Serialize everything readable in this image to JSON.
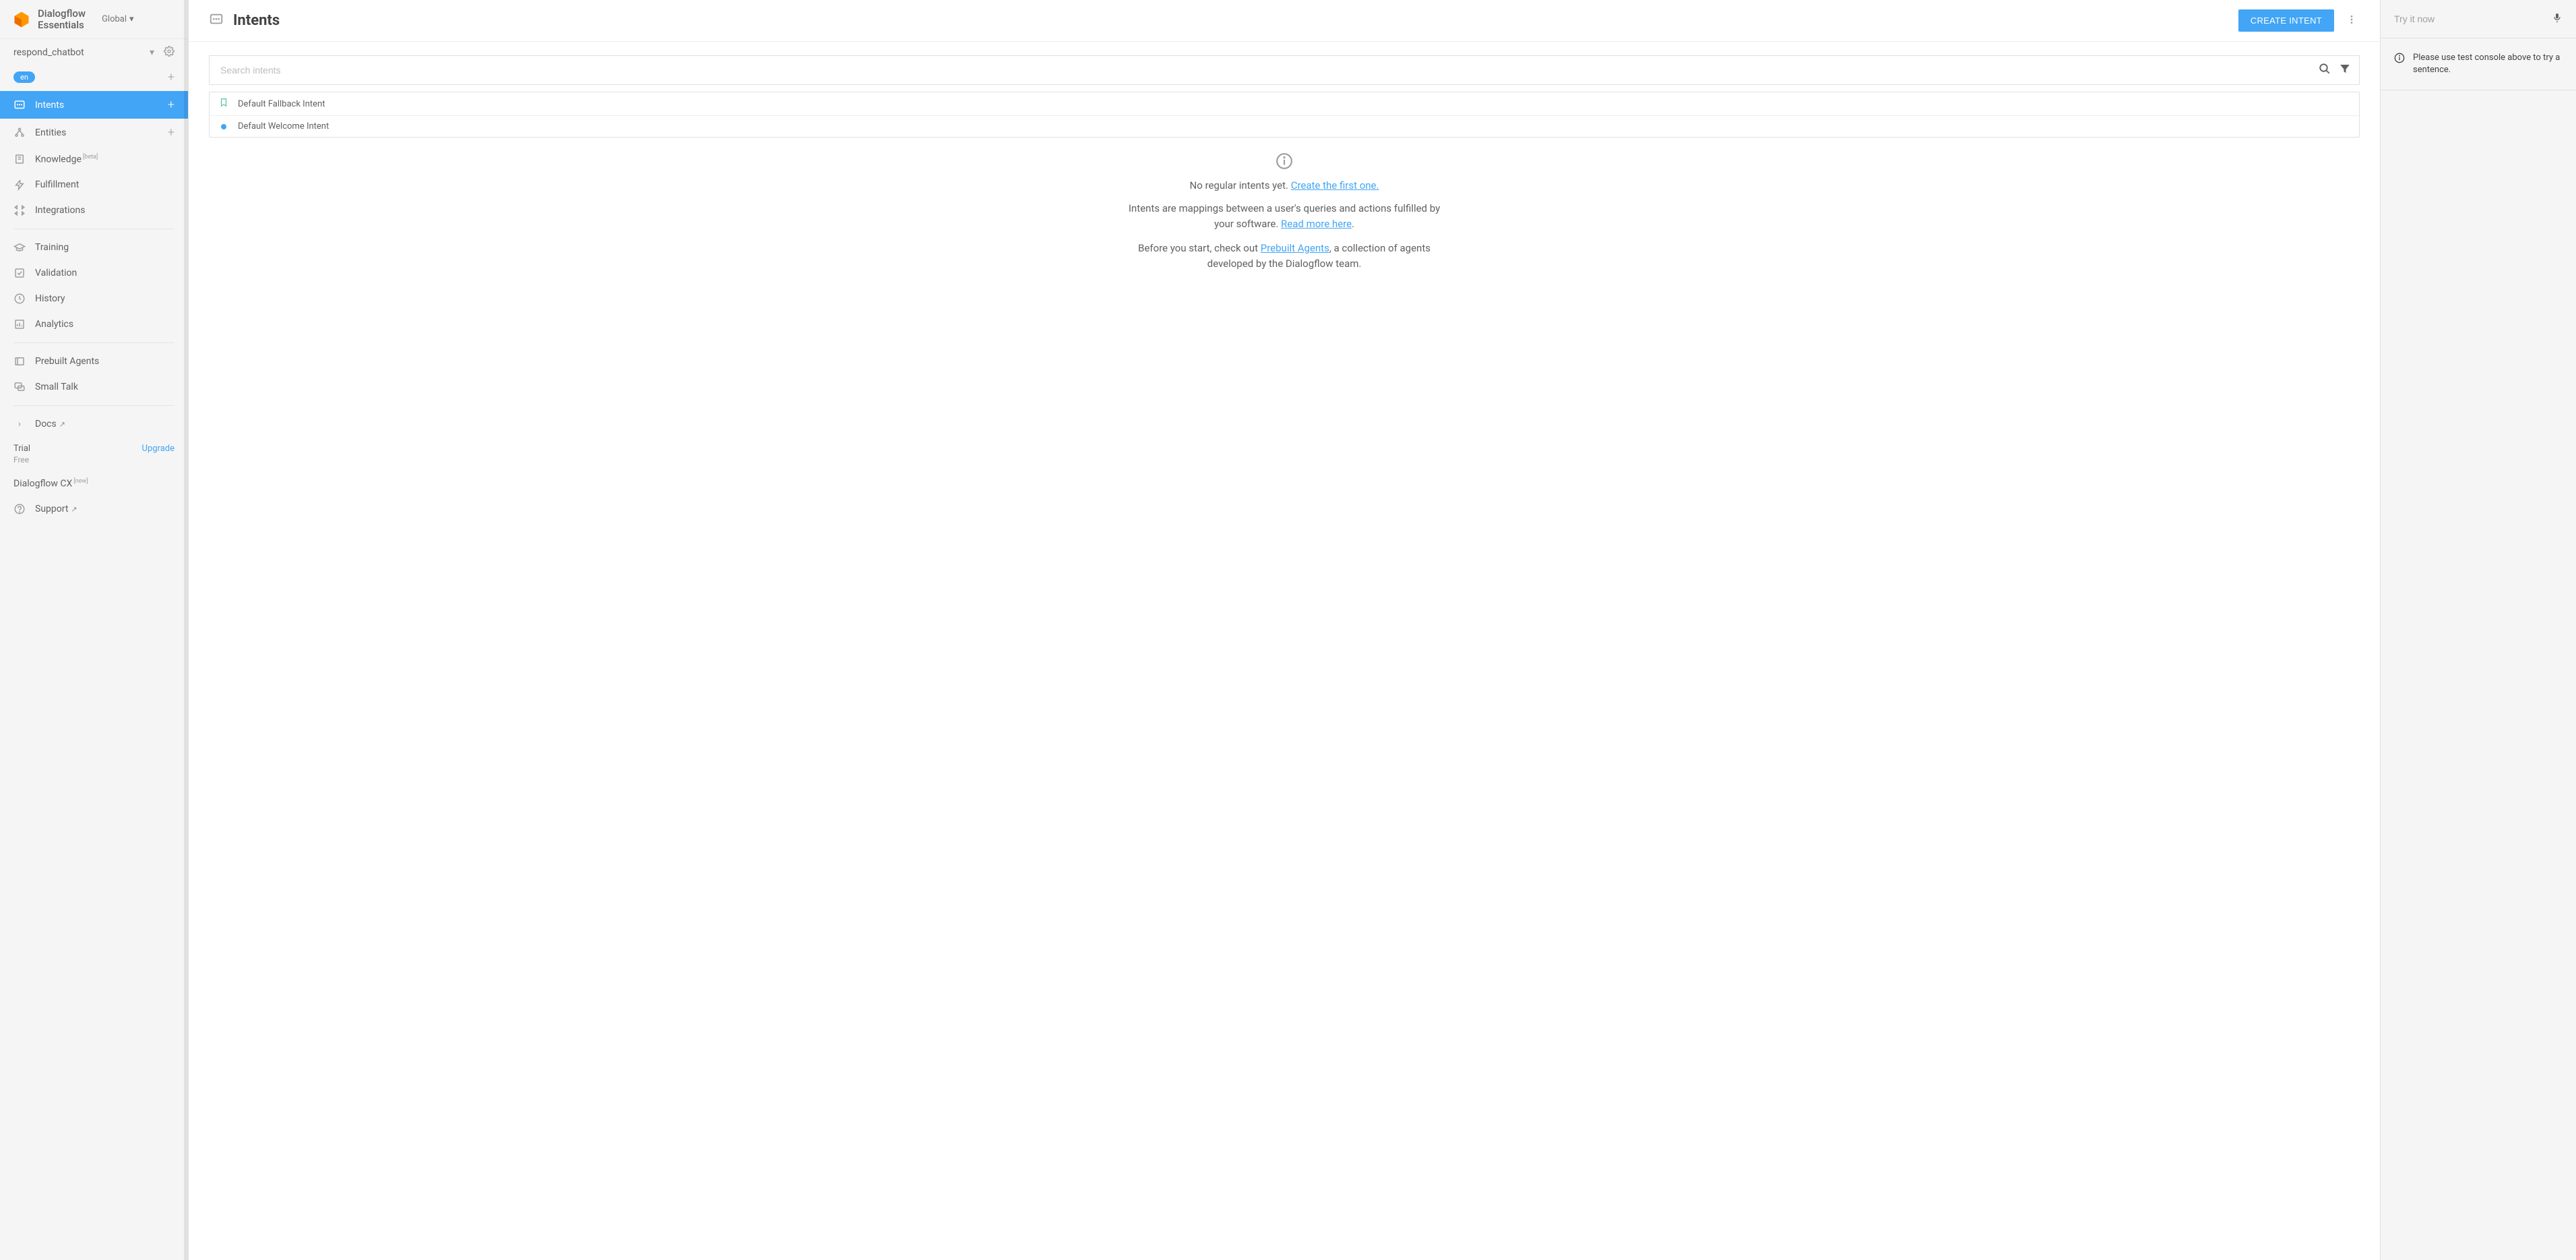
{
  "brand": {
    "line1": "Dialogflow",
    "line2": "Essentials",
    "region": "Global"
  },
  "agent": {
    "name": "respond_chatbot",
    "language": "en"
  },
  "nav": {
    "intents": "Intents",
    "entities": "Entities",
    "knowledge": "Knowledge",
    "knowledge_badge": "[beta]",
    "fulfillment": "Fulfillment",
    "integrations": "Integrations",
    "training": "Training",
    "validation": "Validation",
    "history": "History",
    "analytics": "Analytics",
    "prebuilt_agents": "Prebuilt Agents",
    "small_talk": "Small Talk",
    "docs": "Docs",
    "support": "Support",
    "trial": "Trial",
    "free": "Free",
    "upgrade": "Upgrade",
    "dialogflow_cx": "Dialogflow CX",
    "cx_badge": "[new]"
  },
  "header": {
    "title": "Intents",
    "create_button": "CREATE INTENT"
  },
  "search": {
    "placeholder": "Search intents"
  },
  "intents": {
    "fallback": "Default Fallback Intent",
    "welcome": "Default Welcome Intent"
  },
  "empty": {
    "line1_prefix": "No regular intents yet. ",
    "line1_link": "Create the first one.",
    "line2_prefix": "Intents are mappings between a user's queries and actions fulfilled by your software. ",
    "line2_link": "Read more here",
    "line3_prefix": "Before you start, check out ",
    "line3_link": "Prebuilt Agents",
    "line3_suffix": ", a collection of agents developed by the Dialogflow team."
  },
  "try_panel": {
    "placeholder": "Try it now",
    "note": "Please use test console above to try a sentence."
  }
}
